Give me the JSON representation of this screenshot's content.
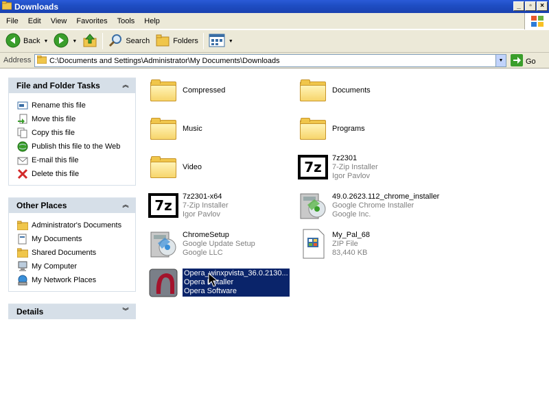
{
  "window": {
    "title": "Downloads"
  },
  "menu": [
    "File",
    "Edit",
    "View",
    "Favorites",
    "Tools",
    "Help"
  ],
  "toolbar": {
    "back": "Back",
    "search": "Search",
    "folders": "Folders"
  },
  "address": {
    "label": "Address",
    "path": "C:\\Documents and Settings\\Administrator\\My Documents\\Downloads",
    "go": "Go"
  },
  "tasks": {
    "title": "File and Folder Tasks",
    "items": [
      "Rename this file",
      "Move this file",
      "Copy this file",
      "Publish this file to the Web",
      "E-mail this file",
      "Delete this file"
    ]
  },
  "other_places": {
    "title": "Other Places",
    "items": [
      "Administrator's Documents",
      "My Documents",
      "Shared Documents",
      "My Computer",
      "My Network Places"
    ]
  },
  "details": {
    "title": "Details"
  },
  "files": [
    {
      "name": "Compressed"
    },
    {
      "name": "Documents"
    },
    {
      "name": "Music"
    },
    {
      "name": "Programs"
    },
    {
      "name": "Video"
    },
    {
      "name": "7z2301",
      "line2": "7-Zip Installer",
      "line3": "Igor Pavlov"
    },
    {
      "name": "7z2301-x64",
      "line2": "7-Zip Installer",
      "line3": "Igor Pavlov"
    },
    {
      "name": "49.0.2623.112_chrome_installer",
      "line2": "Google Chrome Installer",
      "line3": "Google Inc."
    },
    {
      "name": "ChromeSetup",
      "line2": "Google Update Setup",
      "line3": "Google LLC"
    },
    {
      "name": "My_Pal_68",
      "line2": "ZIP File",
      "line3": "83,440 KB"
    },
    {
      "name": "Opera_winxpvista_36.0.2130...",
      "line2": "Opera Installer",
      "line3": "Opera Software"
    }
  ],
  "colors": {
    "selection": "#0a246a",
    "titlebar": "#1f4ec4",
    "panel_header": "#d6dfe8"
  }
}
